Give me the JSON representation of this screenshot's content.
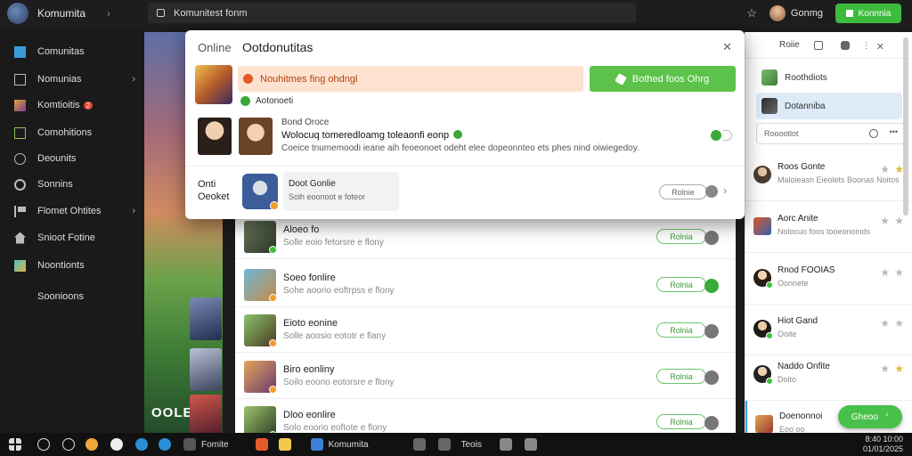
{
  "app": {
    "title": "Komumita"
  },
  "address_bar": {
    "value": "Komunitest fonm"
  },
  "header": {
    "user_name": "Gonmg",
    "action_button": "Konnnia"
  },
  "sidebar": {
    "items": [
      {
        "label": "Comunitas",
        "icon": "cube-icon"
      },
      {
        "label": "Nomunias",
        "icon": "folder-icon"
      },
      {
        "label": "Komtioitis",
        "icon": "game-icon",
        "badge": "2"
      },
      {
        "label": "Comohitions",
        "icon": "panel-icon"
      },
      {
        "label": "Deounits",
        "icon": "circle-icon"
      },
      {
        "label": "Sonnins",
        "icon": "gear-icon"
      },
      {
        "label": "Flomet Ohtites",
        "icon": "flag-icon"
      },
      {
        "label": "Snioot Fotine",
        "icon": "home-icon"
      },
      {
        "label": "Noontionts",
        "icon": "puzzle-icon"
      },
      {
        "label": "Soonioons",
        "icon": ""
      }
    ]
  },
  "banner": {
    "text": "OOLE"
  },
  "modal": {
    "tab": "Online",
    "title": "Ootdonutitas",
    "alert": "Nouhitmes fing ohdngl",
    "primary_button": "Bothed foos Ohrg",
    "check_label": "Aotonoeti",
    "line1": "Bond Oroce",
    "line2": "Wolocuq tomeredloamg toleaonfi eonp",
    "line3": "Coeice tnumemoodi ieane aih feoeonoet odeht elee dopeonnteo ets phes nind oiwiegedoy.",
    "side_label1": "Onti",
    "side_label2": "Oeoket",
    "card_title": "Doot Gonlie",
    "card_sub": "Soih eoonoot e foteor",
    "small_button": "Rolnie"
  },
  "list": {
    "rows": [
      {
        "title": "Aloeo fo",
        "sub": "Solle eoio fetorsre e flony",
        "button": "Rolnia"
      },
      {
        "title": "Soeo fonlire",
        "sub": "Sohe aoorio eoftrpss e flony",
        "button": "Rolnia"
      },
      {
        "title": "Eioto eonine",
        "sub": "Solle aoosio eototr e flany",
        "button": "Rolnia"
      },
      {
        "title": "Biro eonliny",
        "sub": "Soilo eoorio eotorsre e flony",
        "button": "Rolnia"
      },
      {
        "title": "Dloo eonlire",
        "sub": "Solo eoorio eoftote e flony",
        "button": "Rolnia"
      }
    ]
  },
  "right_panel": {
    "header": "Roiie",
    "items": [
      {
        "label": "Roothdiots"
      },
      {
        "label": "Dotanniba"
      }
    ],
    "search_placeholder": "Rooootlot",
    "friends": [
      {
        "name": "Roos Gonte",
        "status": "Maloieasn Eieolets Boonas Noitos"
      },
      {
        "name": "Aorc Anite",
        "status": "Nolocuo foos tooeonoinds"
      },
      {
        "name": "Rnod FOOIAS",
        "status": "Oonnete"
      },
      {
        "name": "Hiot Gand",
        "status": "Ooite"
      },
      {
        "name": "Naddo Onfite",
        "status": "Doito"
      },
      {
        "name": "Doenonnoi",
        "status": "Eoo oo"
      }
    ],
    "float_button": "Gheoo"
  },
  "taskbar": {
    "items": [
      "Fomite",
      "Komumita",
      "Teois"
    ],
    "time": "8:40 10:00",
    "date": "01/01/2025"
  }
}
